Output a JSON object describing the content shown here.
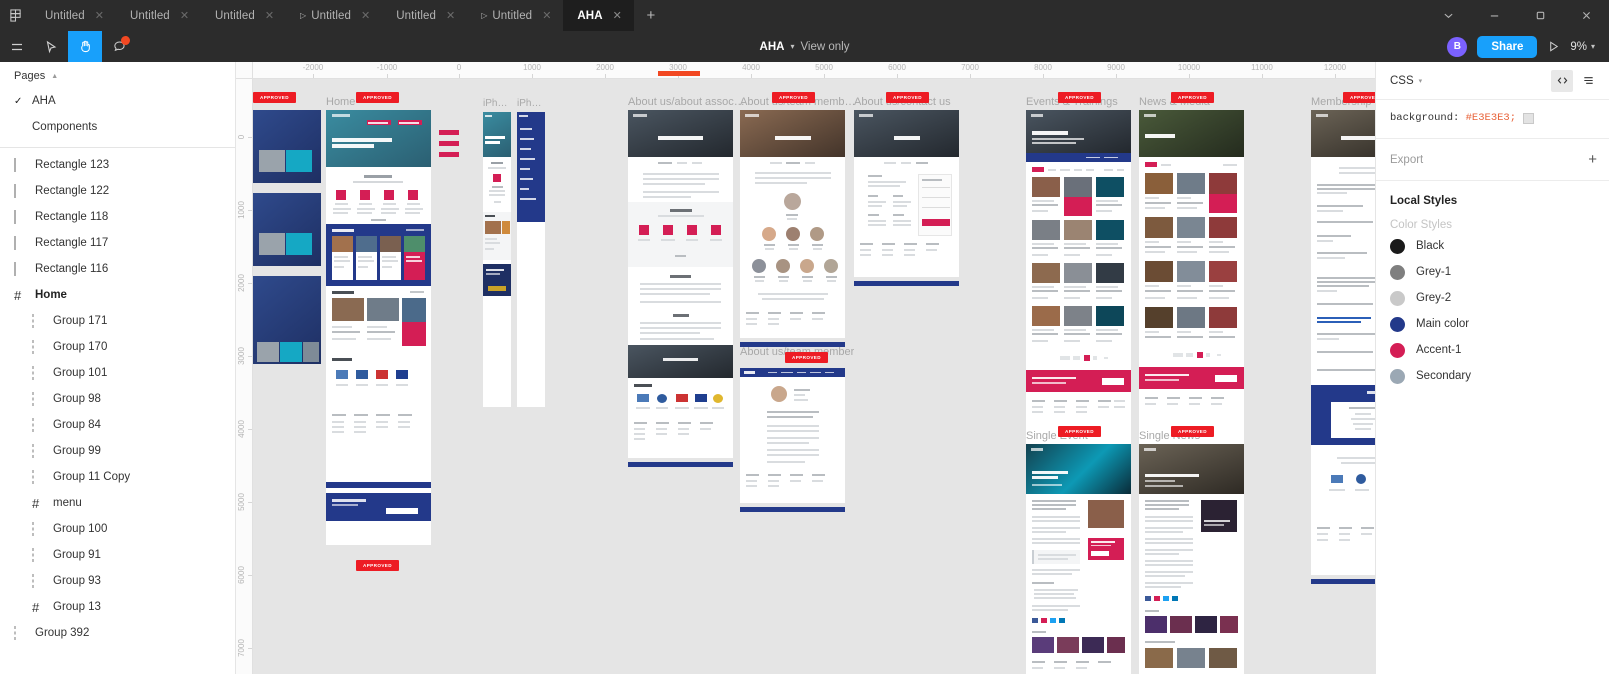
{
  "tabbar": {
    "logo_icon": "figma-logo-icon",
    "tabs": [
      {
        "label": "Untitled",
        "active": false,
        "prototype": false
      },
      {
        "label": "Untitled",
        "active": false,
        "prototype": false
      },
      {
        "label": "Untitled",
        "active": false,
        "prototype": false
      },
      {
        "label": "Untitled",
        "active": false,
        "prototype": true
      },
      {
        "label": "Untitled",
        "active": false,
        "prototype": false
      },
      {
        "label": "Untitled",
        "active": false,
        "prototype": true
      },
      {
        "label": "AHA",
        "active": true,
        "prototype": false
      }
    ],
    "add_tab_label": "+",
    "close_glyph": "✕",
    "window": {
      "chevron_icon": "chevron-down-icon",
      "minimize_icon": "minimize-icon",
      "maximize_icon": "maximize-icon",
      "close_icon": "close-icon"
    }
  },
  "toolbar": {
    "menu_icon": "hamburger-menu-icon",
    "move_icon": "move-cursor-icon",
    "hand_icon": "hand-tool-icon",
    "comment_icon": "comment-icon",
    "hand_active": true,
    "has_notification": true,
    "doc_title": "AHA",
    "doc_caret": "▾",
    "view_only": "View only",
    "avatar_initial": "B",
    "share_label": "Share",
    "present_icon": "present-play-icon",
    "zoom_level": "9%",
    "zoom_caret": "▾"
  },
  "left_panel": {
    "pages_header": "Pages",
    "pages": [
      {
        "name": "AHA",
        "selected": true
      },
      {
        "name": "Components",
        "selected": false
      }
    ],
    "layers": [
      {
        "name": "Rectangle 123",
        "icon": "rectangle-icon",
        "indent": 0,
        "bold": false
      },
      {
        "name": "Rectangle 122",
        "icon": "rectangle-icon",
        "indent": 0,
        "bold": false
      },
      {
        "name": "Rectangle 118",
        "icon": "rectangle-icon",
        "indent": 0,
        "bold": false
      },
      {
        "name": "Rectangle 117",
        "icon": "rectangle-icon",
        "indent": 0,
        "bold": false
      },
      {
        "name": "Rectangle 116",
        "icon": "rectangle-icon",
        "indent": 0,
        "bold": false
      },
      {
        "name": "Home",
        "icon": "frame-icon",
        "indent": 0,
        "bold": true
      },
      {
        "name": "Group 171",
        "icon": "group-icon",
        "indent": 1,
        "bold": false
      },
      {
        "name": "Group 170",
        "icon": "group-icon",
        "indent": 1,
        "bold": false
      },
      {
        "name": "Group 101",
        "icon": "group-icon",
        "indent": 1,
        "bold": false
      },
      {
        "name": "Group 98",
        "icon": "group-icon",
        "indent": 1,
        "bold": false
      },
      {
        "name": "Group 84",
        "icon": "group-icon",
        "indent": 1,
        "bold": false
      },
      {
        "name": "Group 99",
        "icon": "group-icon",
        "indent": 1,
        "bold": false
      },
      {
        "name": "Group 11 Copy",
        "icon": "group-icon",
        "indent": 1,
        "bold": false
      },
      {
        "name": "menu",
        "icon": "frame-icon",
        "indent": 1,
        "bold": false
      },
      {
        "name": "Group 100",
        "icon": "group-icon",
        "indent": 1,
        "bold": false
      },
      {
        "name": "Group 91",
        "icon": "group-icon",
        "indent": 1,
        "bold": false
      },
      {
        "name": "Group 93",
        "icon": "group-icon",
        "indent": 1,
        "bold": false
      },
      {
        "name": "Group 13",
        "icon": "frame-icon",
        "indent": 1,
        "bold": false
      },
      {
        "name": "Group 392",
        "icon": "group-icon",
        "indent": 0,
        "bold": false
      }
    ]
  },
  "right_panel": {
    "section_label": "CSS",
    "caret": "▾",
    "code_view_icon": "code-brackets-icon",
    "list_view_icon": "list-lines-icon",
    "css_property": "background:",
    "css_value": "#E3E3E3;",
    "css_swatch_color": "#E3E3E3",
    "export_label": "Export",
    "export_add": "+",
    "local_styles_title": "Local Styles",
    "color_styles_label": "Color Styles",
    "color_styles": [
      {
        "name": "Black",
        "hex": "#1A1A1A"
      },
      {
        "name": "Grey-1",
        "hex": "#7F7F7F"
      },
      {
        "name": "Grey-2",
        "hex": "#C9C9C9"
      },
      {
        "name": "Main color",
        "hex": "#23398A"
      },
      {
        "name": "Accent-1",
        "hex": "#D41E55"
      },
      {
        "name": "Secondary",
        "hex": "#9BA8B4"
      }
    ]
  },
  "canvas": {
    "background": "#E5E5E5",
    "ruler_h_ticks": [
      "-2000",
      "-1000",
      "0",
      "1000",
      "2000",
      "3000",
      "4000",
      "5000",
      "6000",
      "7000",
      "8000",
      "9000",
      "10000",
      "11000",
      "12000"
    ],
    "ruler_v_ticks": [
      "0",
      "1000",
      "2000",
      "3000",
      "4000",
      "5000",
      "6000",
      "7000"
    ],
    "approved_badge": "APPROVED",
    "frames": [
      {
        "label": "",
        "name": "frame-untitled-left"
      },
      {
        "label": "Home",
        "name": "frame-home"
      },
      {
        "label": "iPh…",
        "name": "frame-iphone-1"
      },
      {
        "label": "iPh…",
        "name": "frame-iphone-2"
      },
      {
        "label": "About us/about assoc…",
        "name": "frame-about-association"
      },
      {
        "label": "About us/team memb…",
        "name": "frame-team-members"
      },
      {
        "label": "About us/contact us",
        "name": "frame-contact-us"
      },
      {
        "label": "About us/team member",
        "name": "frame-single-team-member"
      },
      {
        "label": "Events & Trainings",
        "name": "frame-events-trainings"
      },
      {
        "label": "News & Media",
        "name": "frame-news-media"
      },
      {
        "label": "Single Event",
        "name": "frame-single-event"
      },
      {
        "label": "Single News",
        "name": "frame-single-news"
      },
      {
        "label": "Membership-r…",
        "name": "frame-membership"
      }
    ]
  }
}
